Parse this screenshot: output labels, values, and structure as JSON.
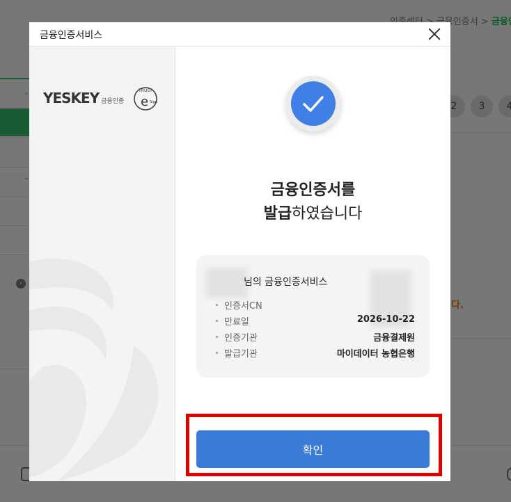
{
  "background": {
    "breadcrumb": "인증센터 > 금융인증서 > ",
    "breadcrumb_current": "금융인",
    "pages": [
      "2",
      "3",
      "4"
    ],
    "notice_tail": "다."
  },
  "modal": {
    "title": "금융인증서비스",
    "brand": {
      "name": "YESKEY",
      "sub": "금융인증",
      "seal_top": "TRUST",
      "seal_e": "e",
      "seal_sign": "Sign"
    },
    "message_line1": "금융인증서를",
    "message_line2_bold": "발급",
    "message_line2_rest": "하였습니다",
    "cert_card": {
      "name": "님의 금융인증서비스",
      "rows": [
        {
          "label": "인증서CN",
          "value": ""
        },
        {
          "label": "만료일",
          "value": "2026-10-22"
        },
        {
          "label": "인증기관",
          "value": "금융결제원"
        },
        {
          "label": "발급기관",
          "value": "마이데이터 농협은행"
        }
      ]
    },
    "confirm_label": "확인"
  },
  "colors": {
    "accent": "#3a7ad9",
    "check": "#3f7fe6",
    "highlight": "#e00000",
    "brand_green": "#1a5b33"
  }
}
